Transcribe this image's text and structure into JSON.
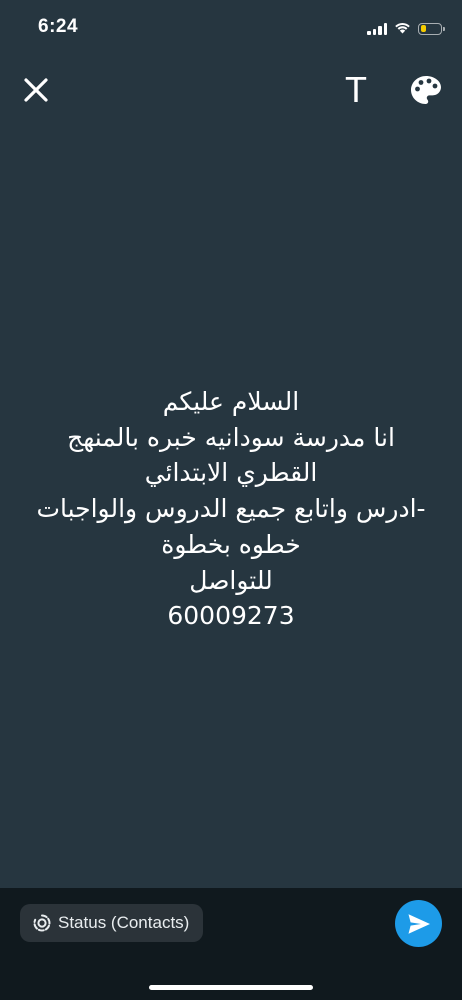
{
  "status_bar": {
    "time": "6:24",
    "battery_level": 0.25,
    "battery_color": "#f5cc00",
    "icons": [
      "cellular-signal-icon",
      "wifi-icon",
      "battery-icon"
    ]
  },
  "toolbar": {
    "close_icon": "close-icon",
    "text_tool_label": "T",
    "palette_icon": "palette-icon"
  },
  "status_update": {
    "text": "السلام عليكم\nانا مدرسة سودانيه خبره بالمنهج\nالقطري الابتدائي\n-ادرس واتابع جميع الدروس والواجبات\nخطوه بخطوة\nللتواصل\n60009273",
    "background_color": "#263640",
    "text_color": "#ffffff"
  },
  "footer": {
    "audience_label": "Status (Contacts)",
    "audience_icon": "status-ring-icon",
    "send_icon": "send-icon",
    "send_color": "#1d9be8"
  }
}
